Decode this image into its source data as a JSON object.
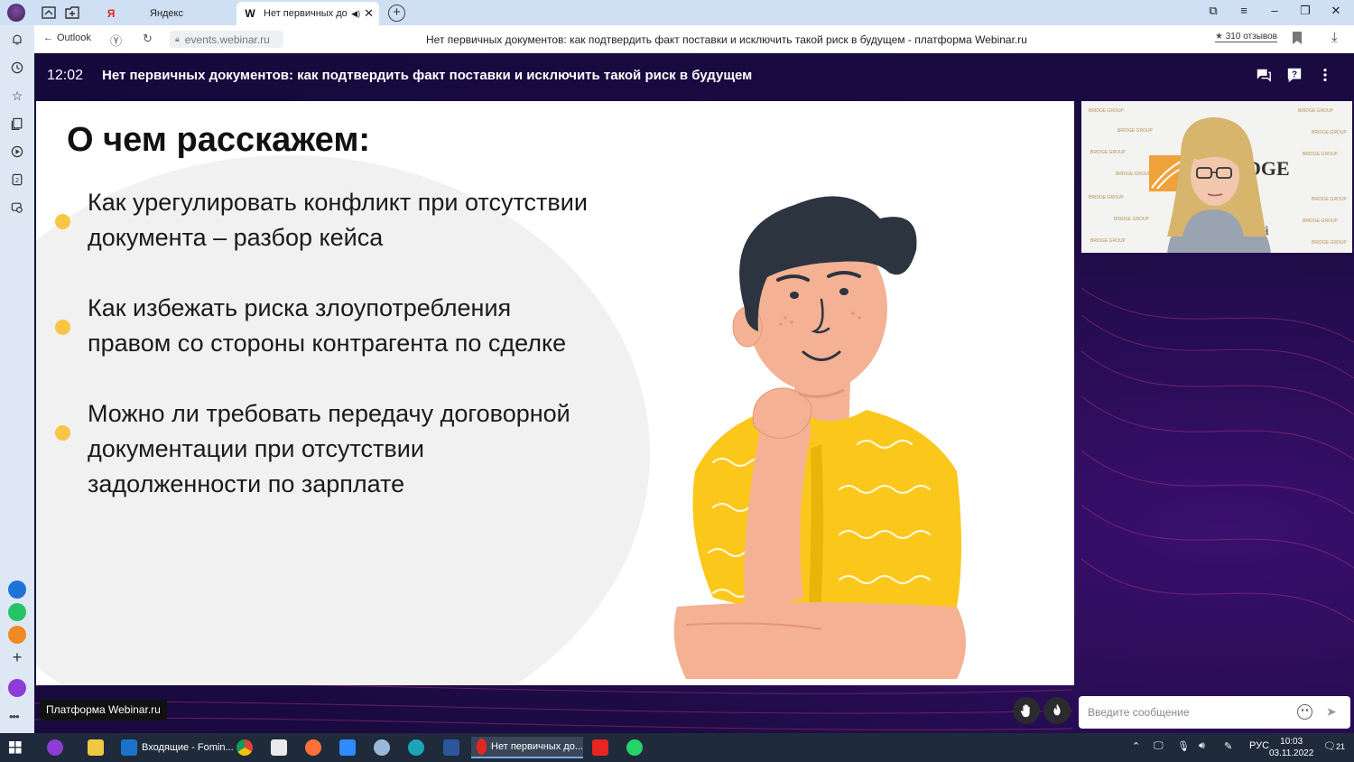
{
  "browser": {
    "tabs": [
      {
        "label": "Яндекс",
        "favicon": "Я"
      },
      {
        "label": "Нет первичных документов",
        "favicon": "W",
        "active": true
      }
    ],
    "back_label": "Outlook",
    "url": "events.webinar.ru",
    "page_title": "Нет первичных документов: как подтвердить факт поставки и исключить такой риск в будущем - платформа Webinar.ru",
    "reviews_count": "310 отзывов"
  },
  "webinar": {
    "time": "12:02",
    "title": "Нет первичных документов: как подтвердить факт поставки и исключить такой риск в будущем",
    "slide": {
      "title": "О чем расскажем:",
      "bullets": [
        {
          "line1": "Как урегулировать конфликт при отсутствии",
          "line2": "документа – разбор кейса"
        },
        {
          "line1": "Как избежать риска злоупотребления",
          "line2": "правом со стороны контрагента по сделке"
        },
        {
          "line1": "Можно ли требовать передачу договорной",
          "line2": "документации при отсутствии",
          "line3": "задолженности по зарплате"
        }
      ]
    },
    "camera": {
      "logo_text": "DGE",
      "logo_sub": "P",
      "wall_text": "BRIDGE GROUP",
      "side_char": "й"
    },
    "brand_label": "Платформа Webinar.ru",
    "chat_placeholder": "Введите сообщение"
  },
  "taskbar": {
    "apps": [
      {
        "label": "Входящие - Fomin...",
        "icon": "outlook-icon"
      },
      {
        "label": "Нет первичных до...",
        "icon": "yandex-browser-icon",
        "active": true
      }
    ],
    "lang": "РУС",
    "time": "10:03",
    "date": "03.11.2022",
    "notifications": "21"
  },
  "colors": {
    "accent_yellow": "#f8c644",
    "stage_bg": "#1d0b45",
    "tabbar_bg": "#cfe0f5"
  }
}
